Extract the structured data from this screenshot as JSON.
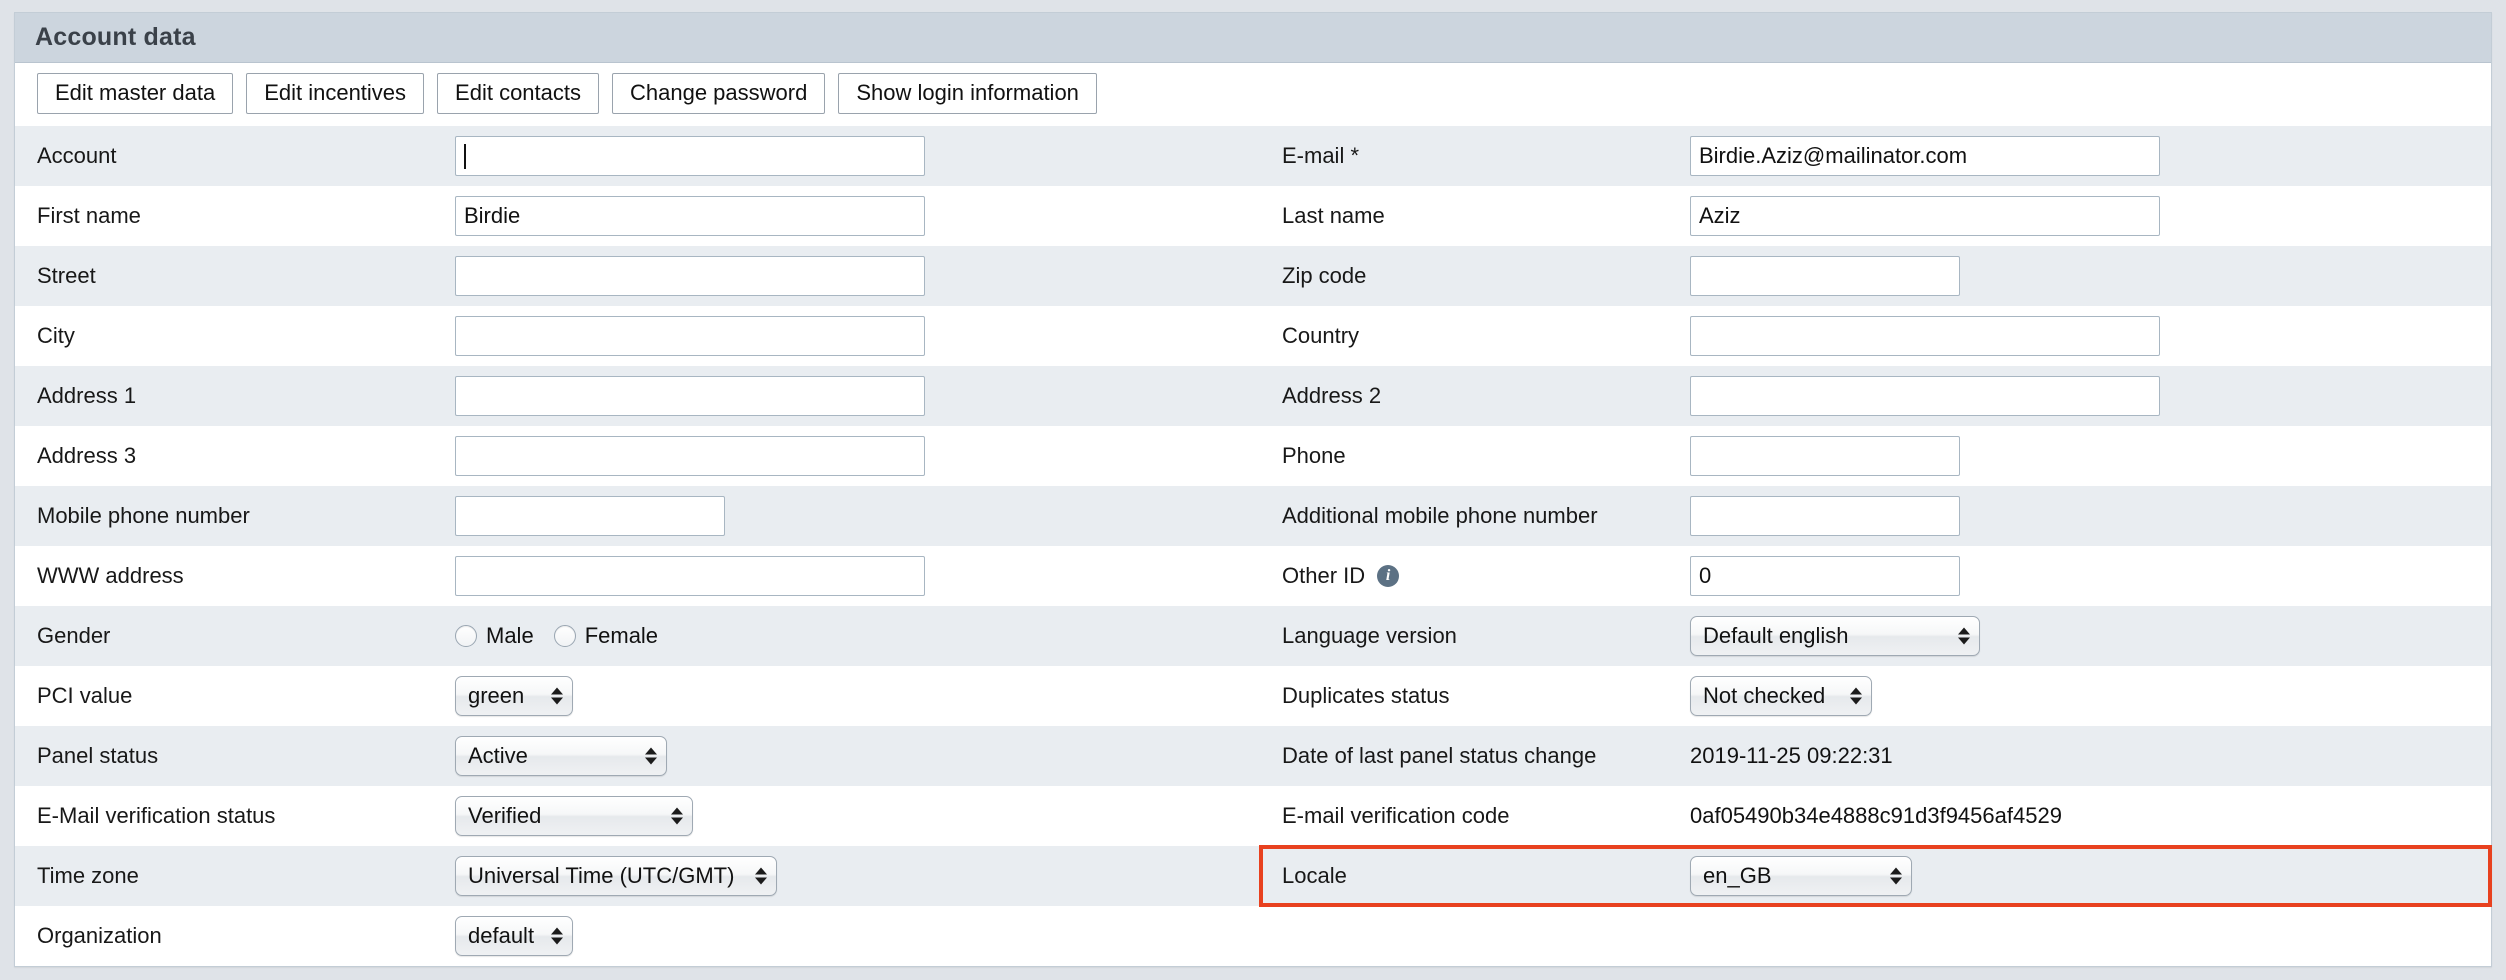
{
  "panel": {
    "title": "Account data"
  },
  "toolbar": {
    "buttons": [
      {
        "label": "Edit master data"
      },
      {
        "label": "Edit incentives"
      },
      {
        "label": "Edit contacts"
      },
      {
        "label": "Change password"
      },
      {
        "label": "Show login information"
      }
    ]
  },
  "form": {
    "rows": [
      {
        "left": {
          "label": "Account",
          "value": ""
        },
        "right": {
          "label": "E-mail *",
          "value": "Birdie.Aziz@mailinator.com"
        }
      },
      {
        "left": {
          "label": "First name",
          "value": "Birdie"
        },
        "right": {
          "label": "Last name",
          "value": "Aziz"
        }
      },
      {
        "left": {
          "label": "Street",
          "value": ""
        },
        "right": {
          "label": "Zip code",
          "value": ""
        }
      },
      {
        "left": {
          "label": "City",
          "value": ""
        },
        "right": {
          "label": "Country",
          "value": ""
        }
      },
      {
        "left": {
          "label": "Address 1",
          "value": ""
        },
        "right": {
          "label": "Address 2",
          "value": ""
        }
      },
      {
        "left": {
          "label": "Address 3",
          "value": ""
        },
        "right": {
          "label": "Phone",
          "value": ""
        }
      },
      {
        "left": {
          "label": "Mobile phone number",
          "value": ""
        },
        "right": {
          "label": "Additional mobile phone number",
          "value": ""
        }
      },
      {
        "left": {
          "label": "WWW address",
          "value": ""
        },
        "right": {
          "label": "Other ID",
          "icon": "info-icon",
          "value": "0"
        }
      }
    ],
    "gender": {
      "label": "Gender",
      "options": [
        {
          "label": "Male",
          "selected": false
        },
        {
          "label": "Female",
          "selected": false
        }
      ]
    },
    "language_version": {
      "label": "Language version",
      "value": "Default english"
    },
    "pci_value": {
      "label": "PCI value",
      "value": "green"
    },
    "duplicates_status": {
      "label": "Duplicates status",
      "value": "Not checked"
    },
    "panel_status": {
      "label": "Panel status",
      "value": "Active"
    },
    "date_last_panel_status_change": {
      "label": "Date of last panel status change",
      "value": "2019-11-25 09:22:31"
    },
    "email_verification_status": {
      "label": "E-Mail verification status",
      "value": "Verified"
    },
    "email_verification_code": {
      "label": "E-mail verification code",
      "value": "0af05490b34e4888c91d3f9456af4529"
    },
    "time_zone": {
      "label": "Time zone",
      "value": "Universal Time (UTC/GMT)"
    },
    "locale": {
      "label": "Locale",
      "value": "en_GB",
      "highlight_color": "#e8411f"
    },
    "organization": {
      "label": "Organization",
      "value": "default"
    }
  }
}
